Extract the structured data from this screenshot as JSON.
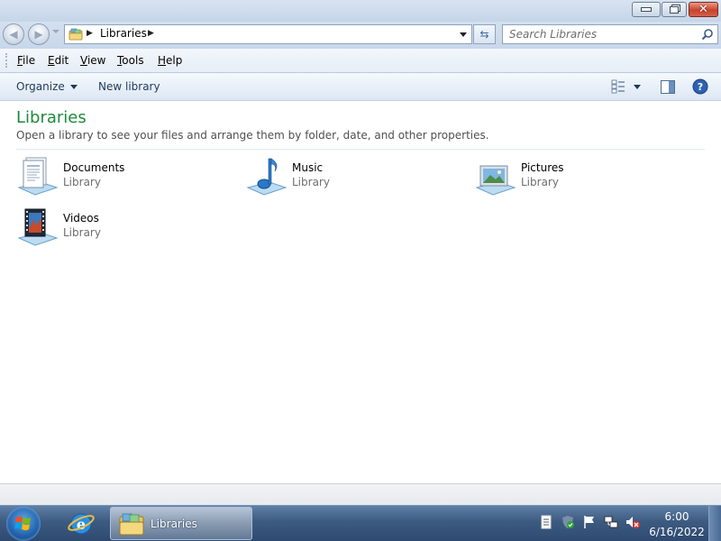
{
  "window": {
    "address": {
      "crumb": "Libraries"
    },
    "search": {
      "placeholder": "Search Libraries"
    },
    "menu": [
      "File",
      "Edit",
      "View",
      "Tools",
      "Help"
    ],
    "commands": {
      "organize": "Organize",
      "new_library": "New library"
    },
    "content": {
      "title": "Libraries",
      "description": "Open a library to see your files and arrange them by folder, date, and other properties.",
      "libraries": [
        {
          "name": "Documents",
          "type": "Library",
          "icon": "documents-library-icon"
        },
        {
          "name": "Music",
          "type": "Library",
          "icon": "music-library-icon"
        },
        {
          "name": "Pictures",
          "type": "Library",
          "icon": "pictures-library-icon"
        },
        {
          "name": "Videos",
          "type": "Library",
          "icon": "videos-library-icon"
        }
      ]
    }
  },
  "taskbar": {
    "task_label": "Libraries",
    "clock": {
      "time": "6:00",
      "date": "6/16/2022"
    }
  },
  "colors": {
    "title_green": "#1e8a3c",
    "taskbar_blue": "#3d5a80",
    "close_red": "#c8432a"
  }
}
